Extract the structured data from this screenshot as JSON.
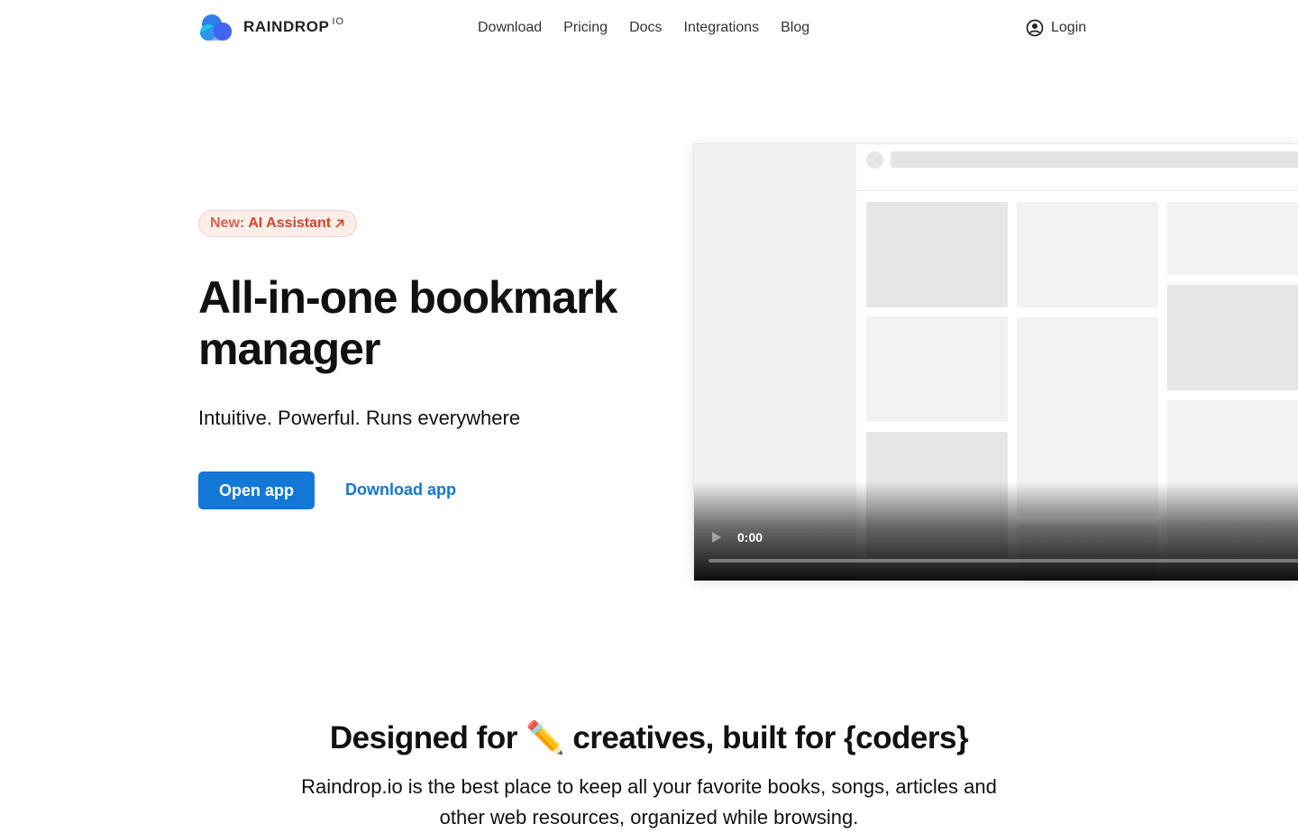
{
  "header": {
    "logo_text": "RAINDROP",
    "logo_sup": "IO",
    "nav": [
      "Download",
      "Pricing",
      "Docs",
      "Integrations",
      "Blog"
    ],
    "login_label": "Login"
  },
  "hero": {
    "badge_new": "New:",
    "badge_label": "AI Assistant",
    "title": "All-in-one bookmark manager",
    "subtitle": "Intuitive. Powerful. Runs everywhere",
    "primary_button": "Open app",
    "secondary_link": "Download app"
  },
  "video": {
    "time": "0:00",
    "progress": 0
  },
  "section": {
    "title": "Designed for ✏️ creatives, built for {coders}",
    "description": "Raindrop.io is the best place to keep all your favorite books, songs, articles and other web resources, organized while browsing."
  },
  "colors": {
    "accent": "#1377d6",
    "badge_text": "#d9442f",
    "badge_bg": "#fdeeea",
    "logo_blue": "#3b6df0",
    "logo_cyan": "#22c3e6"
  }
}
